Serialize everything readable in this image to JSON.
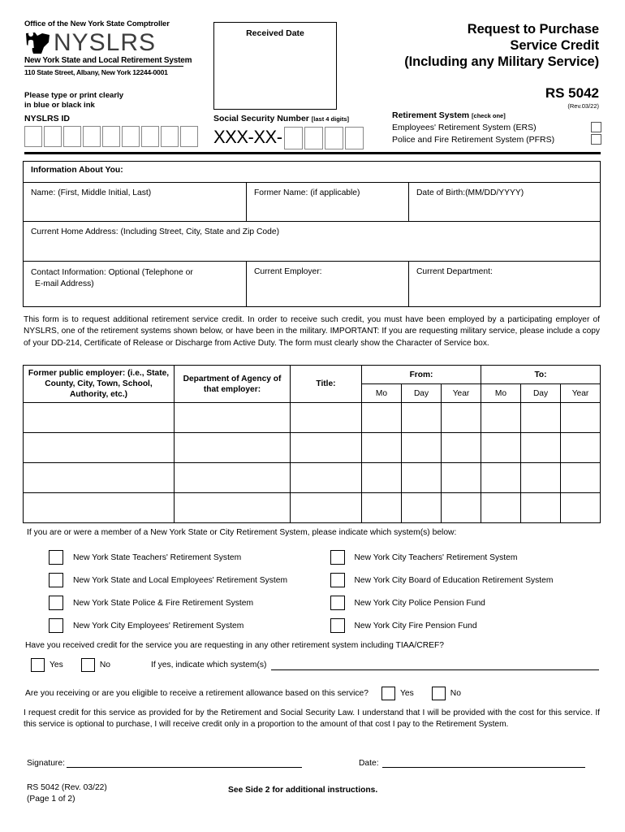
{
  "header": {
    "office_line": "Office of the New York State Comptroller",
    "logo_word": "NYSLRS",
    "logo_subtitle": "New York State and Local Retirement System",
    "address": "110 State Street, Albany, New York 12244-0001",
    "print_note_line1": "Please type or print clearly",
    "print_note_line2": "in blue or black ink",
    "received_date_label": "Received Date",
    "title_line1": "Request to Purchase",
    "title_line2": "Service Credit",
    "title_line3": "(Including any Military Service)",
    "form_number": "RS 5042",
    "revision": "(Rev.03/22)"
  },
  "retirement_system": {
    "heading": "Retirement System",
    "check_one": "[check one]",
    "options": [
      {
        "label": "Employees' Retirement System (ERS)",
        "checked": false
      },
      {
        "label": "Police and Fire Retirement System (PFRS)",
        "checked": false
      }
    ]
  },
  "identifiers": {
    "nyslrs_id_label": "NYSLRS ID",
    "nyslrs_id_box_count": 9,
    "nyslrs_id_value": "",
    "ssn_label": "Social Security Number",
    "ssn_hint": "[last 4 digits]",
    "ssn_mask": "XXX-XX-",
    "ssn_box_count": 4,
    "ssn_value": ""
  },
  "info_about_you": {
    "section_title": "Information About You:",
    "name_label": "Name: (First, Middle Initial, Last)",
    "name_value": "",
    "former_name_label": "Former Name: (if applicable)",
    "former_name_value": "",
    "dob_label": "Date of Birth:(MM/DD/YYYY)",
    "dob_value": "",
    "address_label": "Current Home Address: (Including Street, City, State and Zip Code)",
    "address_value": "",
    "contact_label_line1": "Contact Information: Optional (Telephone or",
    "contact_label_line2": "E-mail Address)",
    "contact_value": "",
    "employer_label": "Current Employer:",
    "employer_value": "",
    "department_label": "Current Department:",
    "department_value": ""
  },
  "intro_paragraph": "This form is to request additional retirement service credit. In order to receive such credit, you must have been employed by a participating employer of NYSLRS, one of the retirement systems shown below, or have been in the military. IMPORTANT: If you are requesting military service, please include a copy of your DD-214, Certificate of Release or Discharge from Active Duty. The form must clearly show the Character of Service box.",
  "employment_table": {
    "headers": {
      "employer": "Former public employer: (i.e., State, County, City, Town, School, Authority, etc.)",
      "department": "Department of Agency of that employer:",
      "title": "Title:",
      "from": "From:",
      "to": "To:",
      "mo": "Mo",
      "day": "Day",
      "year": "Year"
    },
    "rows": [
      {
        "employer": "",
        "department": "",
        "title": "",
        "from_mo": "",
        "from_day": "",
        "from_year": "",
        "to_mo": "",
        "to_day": "",
        "to_year": ""
      },
      {
        "employer": "",
        "department": "",
        "title": "",
        "from_mo": "",
        "from_day": "",
        "from_year": "",
        "to_mo": "",
        "to_day": "",
        "to_year": ""
      },
      {
        "employer": "",
        "department": "",
        "title": "",
        "from_mo": "",
        "from_day": "",
        "from_year": "",
        "to_mo": "",
        "to_day": "",
        "to_year": ""
      },
      {
        "employer": "",
        "department": "",
        "title": "",
        "from_mo": "",
        "from_day": "",
        "from_year": "",
        "to_mo": "",
        "to_day": "",
        "to_year": ""
      }
    ]
  },
  "membership_section": {
    "intro": "If you are or were a member of a New York State or City Retirement System, please indicate which system(s) below:",
    "rows": [
      {
        "left": {
          "label": "New York State Teachers' Retirement System",
          "checked": false
        },
        "right": {
          "label": "New York City Teachers' Retirement System",
          "checked": false
        }
      },
      {
        "left": {
          "label": "New York State and Local Employees' Retirement System",
          "checked": false
        },
        "right": {
          "label": "New York City Board of Education Retirement System",
          "checked": false
        }
      },
      {
        "left": {
          "label": "New York State Police & Fire Retirement System",
          "checked": false
        },
        "right": {
          "label": "New York City Police Pension Fund",
          "checked": false
        }
      },
      {
        "left": {
          "label": "New York City Employees' Retirement System",
          "checked": false
        },
        "right": {
          "label": "New York City Fire Pension Fund",
          "checked": false
        }
      }
    ]
  },
  "questions": {
    "q1_text": "Have you received credit for the service you are requesting in any other retirement system including TIAA/CREF?",
    "q1_yes": "Yes",
    "q1_no": "No",
    "q1_yes_checked": false,
    "q1_no_checked": false,
    "q1_followup": "If yes, indicate which system(s)",
    "q1_followup_value": "",
    "q2_text": "Are you receiving or are you eligible to receive a retirement allowance based on this service?",
    "q2_yes": "Yes",
    "q2_no": "No",
    "q2_yes_checked": false,
    "q2_no_checked": false
  },
  "consent_paragraph": "I request credit for this service as provided for by the Retirement and Social Security Law. I understand that I will be provided with the cost for this service. If this service is optional to purchase, I will receive credit only in a proportion to the amount of that cost I pay to the Retirement System.",
  "signature": {
    "signature_label": "Signature:",
    "signature_value": "",
    "date_label": "Date:",
    "date_value": ""
  },
  "footer": {
    "form_rev_line1": "RS 5042 (Rev. 03/22)",
    "form_rev_line2": "(Page 1 of 2)",
    "see_side_2": "See Side 2 for additional instructions."
  }
}
